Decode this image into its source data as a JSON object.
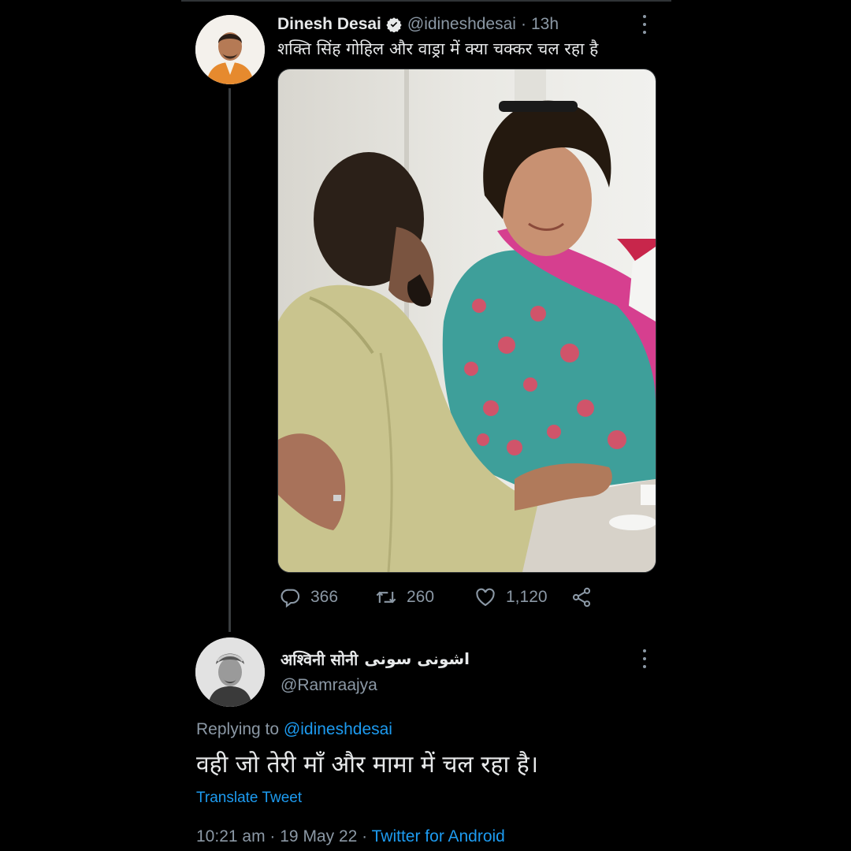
{
  "tweet": {
    "display_name": "Dinesh Desai",
    "handle": "@idineshdesai",
    "separator": "·",
    "time": "13h",
    "text": "शक्ति सिंह गोहिल और वाड्रा में क्या चक्कर चल रहा है",
    "verified_icon": "verified-badge-icon",
    "actions": {
      "reply_count": "366",
      "retweet_count": "260",
      "like_count": "1,120"
    }
  },
  "reply": {
    "display_name": "अश्विनी सोनी",
    "display_name_extra": "اشونی سونی",
    "handle": "@Ramraajya",
    "replying_prefix": "Replying to",
    "replying_to": "@idineshdesai",
    "text": "वही जो तेरी माँ और मामा में चल रहा है।",
    "translate_label": "Translate Tweet",
    "time": "10:21 am",
    "date": "19 May 22",
    "separator": "·",
    "source": "Twitter for Android"
  },
  "colors": {
    "background": "#000000",
    "text_primary": "#e7e9ea",
    "text_secondary": "#8b98a5",
    "accent": "#1d9bf0"
  }
}
